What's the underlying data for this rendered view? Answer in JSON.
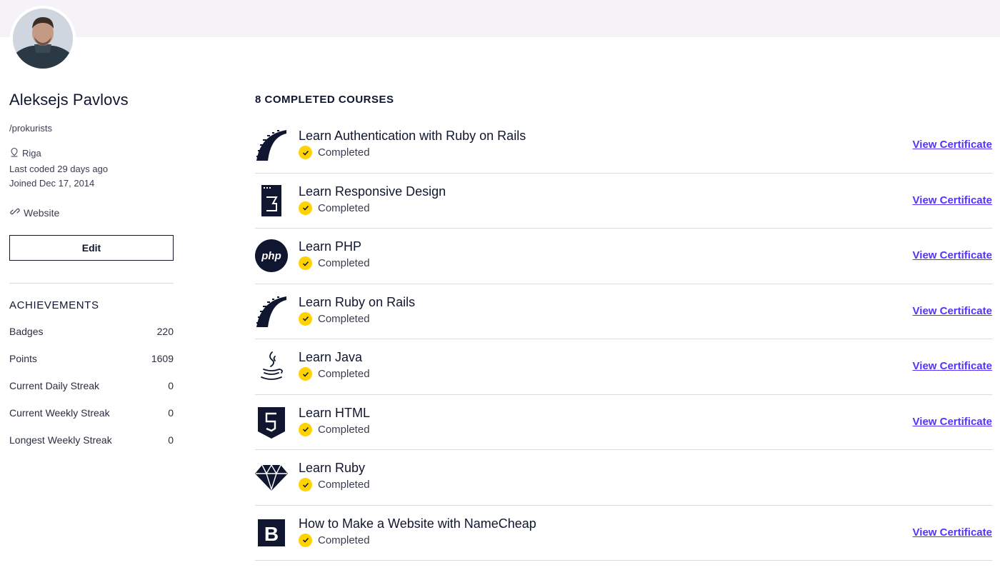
{
  "profile": {
    "name": "Aleksejs Pavlovs",
    "handle": "/prokurists",
    "location": "Riga",
    "last_coded": "Last coded 29 days ago",
    "joined": "Joined Dec 17, 2014",
    "website_label": "Website",
    "edit_label": "Edit"
  },
  "achievements": {
    "title": "ACHIEVEMENTS",
    "rows": [
      {
        "label": "Badges",
        "value": "220"
      },
      {
        "label": "Points",
        "value": "1609"
      },
      {
        "label": "Current Daily Streak",
        "value": "0"
      },
      {
        "label": "Current Weekly Streak",
        "value": "0"
      },
      {
        "label": "Longest Weekly Streak",
        "value": "0"
      }
    ]
  },
  "courses": {
    "title": "8 COMPLETED COURSES",
    "items": [
      {
        "name": "Learn Authentication with Ruby on Rails",
        "status": "Completed",
        "icon": "rails-icon",
        "cert": "View Certificate"
      },
      {
        "name": "Learn Responsive Design",
        "status": "Completed",
        "icon": "css3-icon",
        "cert": "View Certificate"
      },
      {
        "name": "Learn PHP",
        "status": "Completed",
        "icon": "php-icon",
        "cert": "View Certificate"
      },
      {
        "name": "Learn Ruby on Rails",
        "status": "Completed",
        "icon": "rails-icon",
        "cert": "View Certificate"
      },
      {
        "name": "Learn Java",
        "status": "Completed",
        "icon": "java-icon",
        "cert": "View Certificate"
      },
      {
        "name": "Learn HTML",
        "status": "Completed",
        "icon": "html5-icon",
        "cert": "View Certificate"
      },
      {
        "name": "Learn Ruby",
        "status": "Completed",
        "icon": "ruby-gem-icon",
        "cert": ""
      },
      {
        "name": "How to Make a Website with NameCheap",
        "status": "Completed",
        "icon": "bootstrap-icon",
        "cert": "View Certificate"
      }
    ]
  },
  "colors": {
    "ink": "#10162f",
    "link": "#5533ff",
    "check_badge": "#ffd300",
    "top_band": "#f5f3f8"
  }
}
